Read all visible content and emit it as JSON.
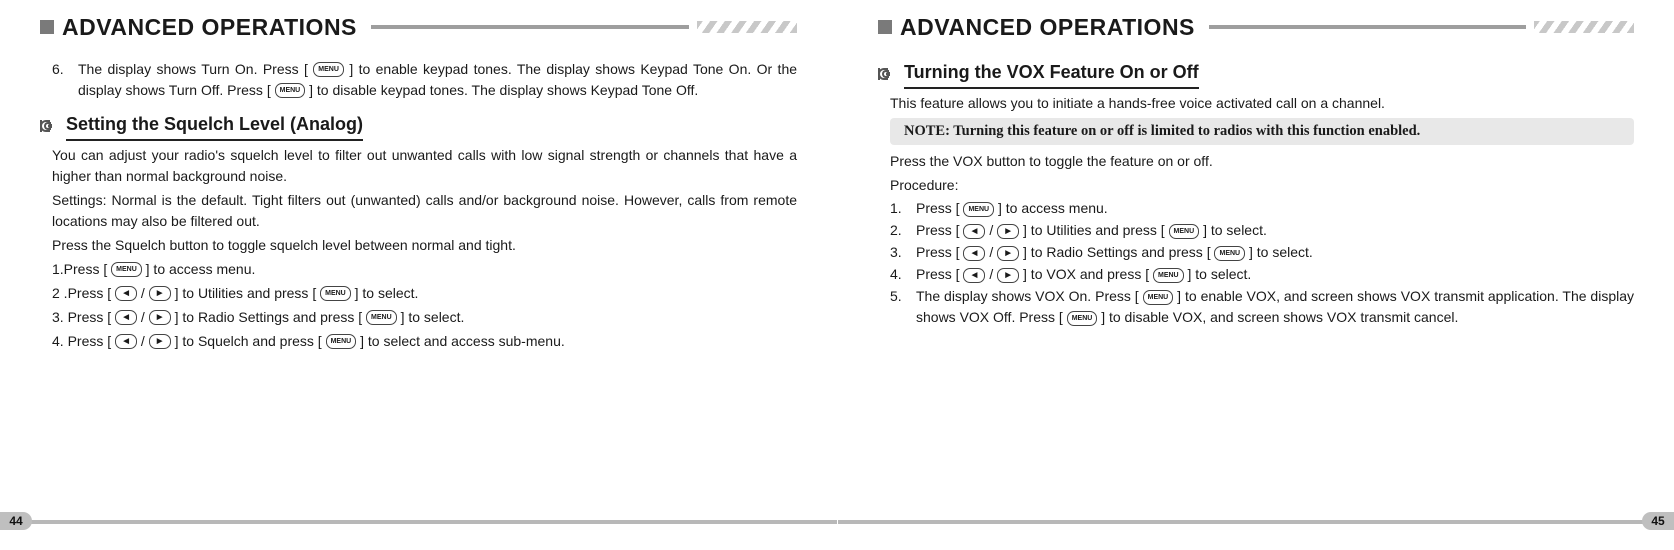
{
  "pages": {
    "left": {
      "title": "ADVANCED OPERATIONS",
      "number": "44"
    },
    "right": {
      "title": "ADVANCED OPERATIONS",
      "number": "45"
    }
  },
  "icons": {
    "menu": "MENU",
    "left": "◄",
    "right": "►"
  },
  "left_page": {
    "step6_num": "6.",
    "step6_a": "The display shows Turn On. Press [",
    "step6_b": "] to enable keypad tones. The display shows Keypad Tone On. Or the display shows Turn Off. Press [",
    "step6_c": "] to disable keypad tones. The display shows Keypad Tone Off.",
    "section1_title": "Setting the Squelch Level (Analog)",
    "para1": "You can adjust your radio's squelch level to filter out unwanted calls with low signal strength or channels that have a higher than normal background noise.",
    "para2": "Settings: Normal is the default. Tight filters out (unwanted) calls and/or background noise. However, calls from remote locations may also be filtered out.",
    "para3": "Press the  Squelch button to toggle squelch level between normal and tight.",
    "s1_a": "1.Press [",
    "s1_b": "] to access menu.",
    "s2_a": "2 .Press [",
    "s2_b": "/",
    "s2_c": "] to Utilities and press [",
    "s2_d": "] to select.",
    "s3_a": "3. Press [",
    "s3_b": "/",
    "s3_c": "] to Radio Settings and press [",
    "s3_d": "] to select.",
    "s4_a": "4. Press [",
    "s4_b": "/",
    "s4_c": "] to Squelch and press [",
    "s4_d": "] to select and access sub-menu."
  },
  "right_page": {
    "section_title": "Turning the VOX Feature On or Off",
    "para_intro": "This feature allows you to initiate a hands-free voice activated  call  on  a   channel.",
    "note": "NOTE: Turning this feature on or off is limited to radios with this function enabled.",
    "para_press": "Press the VOX button to toggle the feature on or off.",
    "para_proc": "Procedure:",
    "r1_n": "1.",
    "r1_a": "Press [",
    "r1_b": "] to access menu.",
    "r2_n": "2.",
    "r2_a": "Press [",
    "r2_b": "/",
    "r2_c": "] to Utilities and press [",
    "r2_d": "] to select.",
    "r3_n": "3.",
    "r3_a": "Press [",
    "r3_b": "/",
    "r3_c": "] to Radio Settings and press [",
    "r3_d": "] to select.",
    "r4_n": "4.",
    "r4_a": "Press [",
    "r4_b": "/",
    "r4_c": "] to VOX and press [",
    "r4_d": "] to select.",
    "r5_n": "5.",
    "r5_a": "The display shows VOX On. Press [",
    "r5_b": "] to enable VOX, and screen shows VOX transmit application. The display shows VOX Off. Press [",
    "r5_c": "] to disable VOX, and screen shows VOX transmit cancel."
  }
}
